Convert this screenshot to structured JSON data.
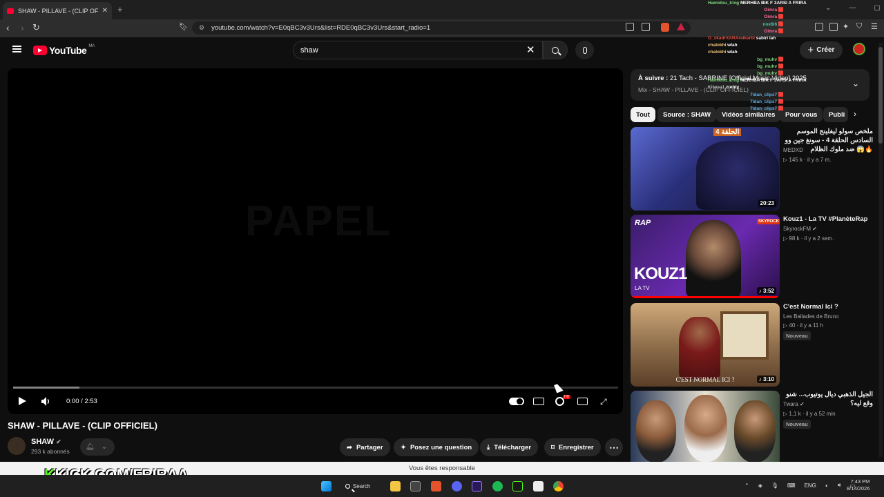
{
  "browser": {
    "tab_title": "SHAW - PILLAVE - (CLIP OFFICIEL)",
    "new_tab": "+",
    "url": "youtube.com/watch?v=E0qBC3v3Urs&list=RDE0qBC3v3Urs&start_radio=1"
  },
  "youtube": {
    "logo_text": "YouTube",
    "country_code": "MA",
    "search_value": "shaw",
    "create_label": "Créer"
  },
  "player": {
    "watermark": "PAPEL",
    "time": "0:00 / 2:53",
    "progress_fraction": 0.11
  },
  "video": {
    "title": "SHAW - PILLAVE - (CLIP OFFICIEL)",
    "channel": "SHAW",
    "subscribers": "293 k abonnés",
    "actions": {
      "share": "Partager",
      "ask": "Posez une question",
      "download": "Télécharger",
      "save": "Enregistrer"
    }
  },
  "playlist": {
    "next_label": "À suivre :",
    "next_title": "21 Tach - SABRINE [Official Music Video] 2025",
    "subtitle": "Mix - SHAW - PILLAVE - (CLIP OFFICIEL)"
  },
  "chips": [
    "Tout",
    "Source : SHAW",
    "Vidéos similaires",
    "Pour vous",
    "Publi"
  ],
  "recommendations": [
    {
      "title": "ملخص سولو ليفلينج الموسم السادس الحلقة 4 - سونغ جين وو ضد ملوك الظلام 😱🔥",
      "channel": "MEDXD",
      "meta": "145 k · il y a 7 m.",
      "duration": "20:23",
      "badge": ""
    },
    {
      "title": "Kouz1 - La TV #PlanèteRap",
      "channel": "SkyrockFM",
      "meta": "98 k · il y a 2 sem.",
      "duration": "3:52",
      "badge": ""
    },
    {
      "title": "C'est Normal Ici ?",
      "channel": "Les Ballades de Bruno",
      "meta": "40 · il y a 11 h",
      "duration": "3:10",
      "badge": "Nouveau"
    },
    {
      "title": "الجيل الذهبي ديال يوتيوب... شنو وقع ليه؟",
      "channel": "Twara",
      "meta": "1,1 k · il y a 52 min",
      "duration": "",
      "badge": "Nouveau"
    }
  ],
  "thumb_text": {
    "t1_badge": "الحلقة 4",
    "t2_brand": "RAP",
    "t2_name": "KOUZ1",
    "t2_sub": "LA TV",
    "t2_logo": "SKYROCK",
    "t3_caption": "C'EST NORMAL ICI ?"
  },
  "notification": "Vous êtes responsable",
  "overlay": {
    "kick_k": "K",
    "kick_text": "KICK.COM/FRIRAA",
    "chat": [
      {
        "user": "Hamidou_k!ng",
        "msg": "MERHBA BIK F 3ARSI A FRIRA",
        "color": "#7fd97f"
      },
      {
        "user": "Oimra",
        "msg": "",
        "color": "#ff6b9a"
      },
      {
        "user": "Oimra",
        "msg": "",
        "color": "#ff6b9a"
      },
      {
        "user": "nox6i6",
        "msg": "",
        "color": "#48c9b0"
      },
      {
        "user": "Oimra",
        "msg": "",
        "color": "#ff6b9a"
      },
      {
        "user": "O_xkadrXARAreikarbi",
        "msg": "sabiri lah",
        "color": "#e74c3c"
      },
      {
        "user": "chalokhi",
        "msg": "wlah",
        "color": "#f0c27b"
      },
      {
        "user": "chalokhi",
        "msg": "wlah",
        "color": "#f0c27b"
      },
      {
        "user": "bg_muhv",
        "msg": "",
        "color": "#7fd97f"
      },
      {
        "user": "bg_muhv",
        "msg": "",
        "color": "#7fd97f"
      },
      {
        "user": "bg_muhv",
        "msg": "",
        "color": "#7fd97f"
      },
      {
        "user": "Hamidou_k!ng",
        "msg": "MERHBA BIK F 3ARSI A FRIRA",
        "color": "#7fd97f"
      },
      {
        "user": "Kiiwaa1",
        "msg": "zrebty",
        "color": "#bbb"
      },
      {
        "user": "7idan_clips7",
        "msg": "",
        "color": "#5dade2"
      },
      {
        "user": "7idan_clips7",
        "msg": "",
        "color": "#5dade2"
      },
      {
        "user": "7idan_clips7",
        "msg": "",
        "color": "#5dade2"
      }
    ]
  },
  "taskbar": {
    "search_label": "Search",
    "lang": "ENG",
    "time": "7:43 PM",
    "date": "8/14/2026"
  }
}
